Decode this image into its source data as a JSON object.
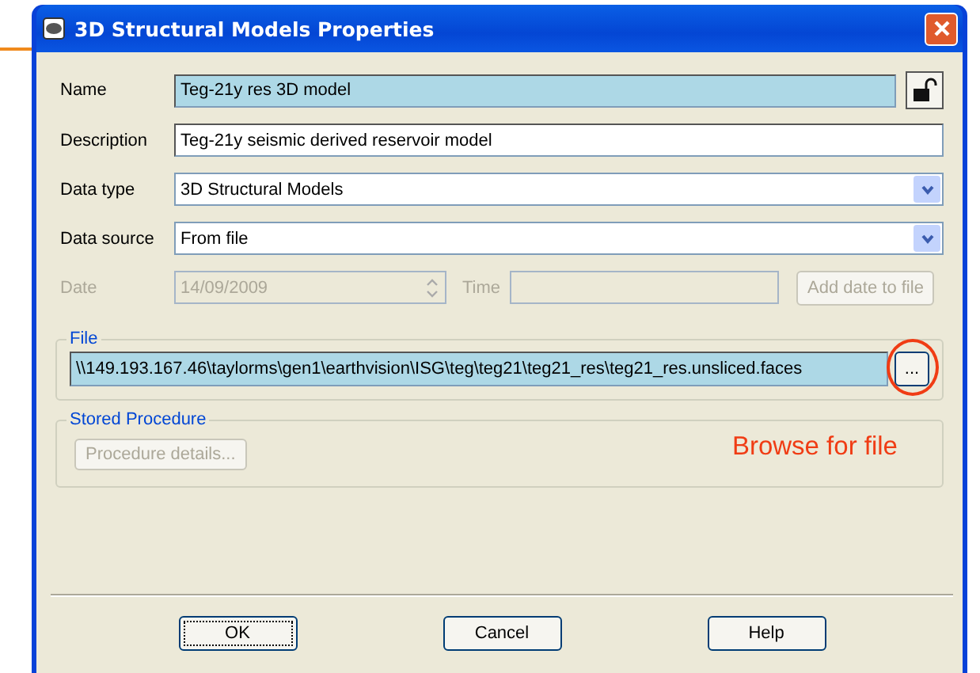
{
  "window": {
    "title": "3D Structural Models Properties"
  },
  "fields": [
    {
      "kind": "text",
      "label": "Name",
      "value": "Teg-21y res 3D model",
      "highlighted": true,
      "lock_button": true
    },
    {
      "kind": "text",
      "label": "Description",
      "value": "Teg-21y seismic derived reservoir model",
      "highlighted": false,
      "lock_button": false
    },
    {
      "kind": "dropdown",
      "label": "Data type",
      "value": "3D Structural Models",
      "highlighted": false,
      "lock_button": false
    },
    {
      "kind": "dropdown",
      "label": "Data source",
      "value": "From file",
      "highlighted": false,
      "lock_button": false
    }
  ],
  "date_row": {
    "label": "Date",
    "value": "14/09/2009",
    "time_label": "Time",
    "button": "Add date to file",
    "disabled": true
  },
  "file_group": {
    "title": "File",
    "path": "\\\\149.193.167.46\\taylorms\\gen1\\earthvision\\ISG\\teg\\teg21\\teg21_res\\teg21_res.unsliced.faces",
    "highlighted": true,
    "browse_button": "..."
  },
  "stored_procedure": {
    "title": "Stored Procedure",
    "button": "Procedure details...",
    "disabled": true
  },
  "annotation": {
    "text": "Browse for file"
  },
  "buttons": [
    {
      "label": "OK",
      "focused": true
    },
    {
      "label": "Cancel",
      "focused": false
    },
    {
      "label": "Help",
      "focused": false
    }
  ]
}
